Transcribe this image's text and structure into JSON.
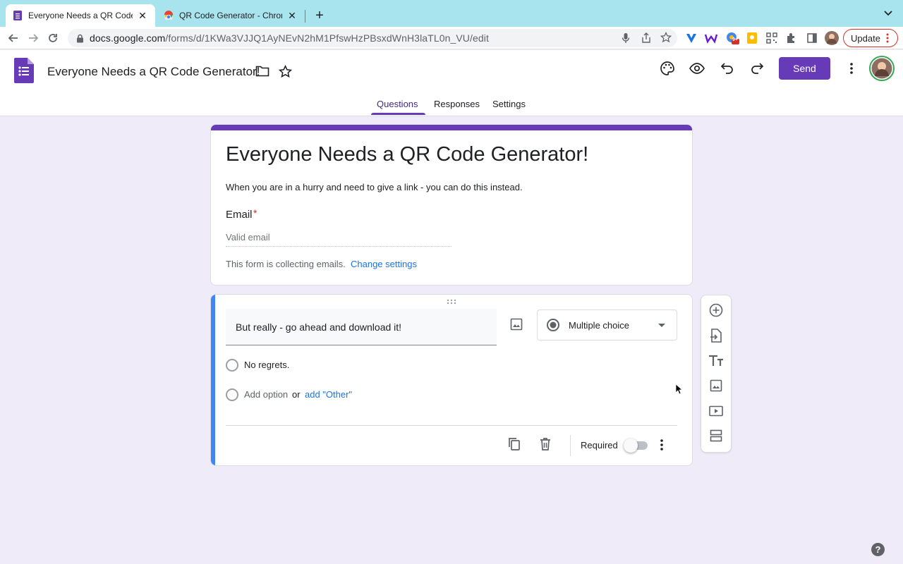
{
  "browser": {
    "tabs": [
      {
        "title": "Everyone Needs a QR Code Ge",
        "active": true
      },
      {
        "title": "QR Code Generator - Chrome",
        "active": false
      }
    ],
    "url_host": "docs.google.com",
    "url_path": "/forms/d/1KWa3VJJQ1AyNEvN2hM1PfswHzPBsxdWnH3laTL0n_VU/edit",
    "update_label": "Update",
    "extension_badge": "9+"
  },
  "header": {
    "doc_title": "Everyone Needs a QR Code Generator!",
    "send_label": "Send",
    "accent_color": "#673ab7"
  },
  "nav_tabs": [
    {
      "label": "Questions",
      "active": true
    },
    {
      "label": "Responses",
      "active": false
    },
    {
      "label": "Settings",
      "active": false
    }
  ],
  "form": {
    "title": "Everyone Needs a QR Code Generator!",
    "description": "When you are in a hurry and need to give a link - you can do this instead.",
    "email_label": "Email",
    "required_mark": "*",
    "email_placeholder": "Valid email",
    "collecting_text": "This form is collecting emails.",
    "change_settings": "Change settings"
  },
  "question": {
    "title": "But really - go ahead and download it!",
    "type": "Multiple choice",
    "options": [
      "No regrets."
    ],
    "add_option": "Add option",
    "or_text": "or",
    "add_other": "add \"Other\"",
    "required_label": "Required",
    "required_on": false
  },
  "side_toolbar": [
    "add-question",
    "import-questions",
    "add-title",
    "add-image",
    "add-video",
    "add-section"
  ],
  "help": "?"
}
